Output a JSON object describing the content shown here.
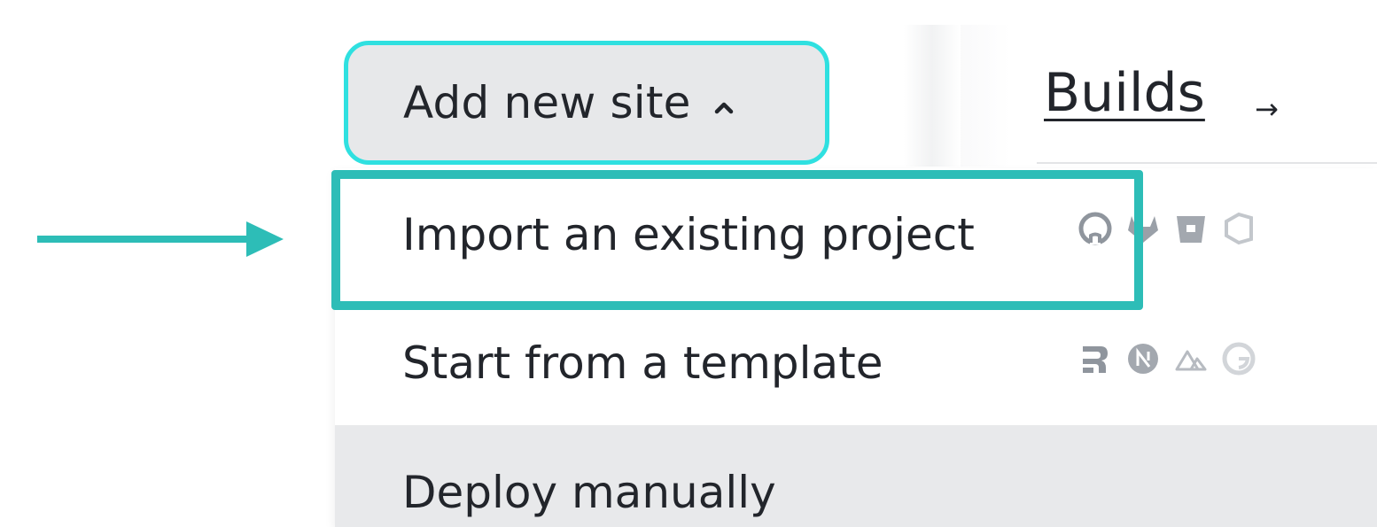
{
  "header": {
    "add_site_label": "Add new site",
    "builds_label": "Builds",
    "builds_arrow": "→"
  },
  "menu": {
    "items": [
      {
        "label": "Import an existing project",
        "icons": [
          "github-icon",
          "gitlab-icon",
          "bitbucket-icon",
          "azure-devops-icon"
        ]
      },
      {
        "label": "Start from a template",
        "icons": [
          "remix-icon",
          "nextjs-icon",
          "nuxt-icon",
          "gatsby-icon"
        ]
      },
      {
        "label": "Deploy manually",
        "icons": []
      }
    ]
  },
  "colors": {
    "focus_ring": "#2fe0e0",
    "annotation": "#2dbdb7",
    "button_bg": "#e7e8ea",
    "hover_row_bg": "#e8e9eb",
    "icon_gray": "#9aa0a8"
  }
}
